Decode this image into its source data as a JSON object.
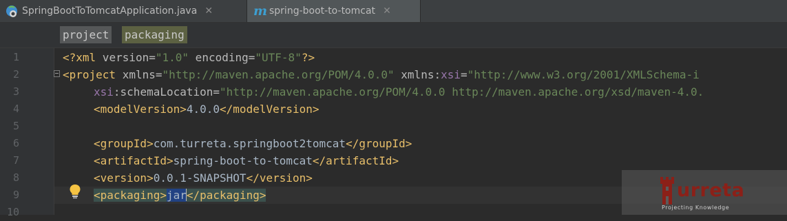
{
  "tabs": [
    {
      "label": "SpringBootToTomcatApplication.java",
      "icon": "spring-java-class-icon",
      "active": false
    },
    {
      "label": "spring-boot-to-tomcat",
      "icon": "maven-m-icon",
      "active": true
    }
  ],
  "breadcrumb": [
    "project",
    "packaging"
  ],
  "line_numbers": [
    "1",
    "2",
    "3",
    "4",
    "5",
    "6",
    "7",
    "8",
    "9",
    "10"
  ],
  "code": {
    "l1": {
      "open": "<?xml",
      "a1": " version",
      "eq1": "=",
      "v1": "\"1.0\"",
      "a2": " encoding",
      "eq2": "=",
      "v2": "\"UTF-8\"",
      "close": "?>"
    },
    "l2": {
      "open": "<project",
      "a1": " xmlns",
      "eq1": "=",
      "v1": "\"http://maven.apache.org/POM/4.0.0\"",
      "a2": " xmlns:",
      "ns": "xsi",
      "eq2": "=",
      "v2": "\"http://www.w3.org/2001/XMLSchema-i"
    },
    "l3": {
      "ns": "xsi",
      "a1": ":schemaLocation",
      "eq1": "=",
      "v1": "\"http://maven.apache.org/POM/4.0.0 http://maven.apache.org/xsd/maven-4.0."
    },
    "l4": {
      "open": "<modelVersion>",
      "text": "4.0.0",
      "close": "</modelVersion>"
    },
    "l6": {
      "open": "<groupId>",
      "text": "com.turreta.springboot2tomcat",
      "close": "</groupId>"
    },
    "l7": {
      "open": "<artifactId>",
      "text": "spring-boot-to-tomcat",
      "close": "</artifactId>"
    },
    "l8": {
      "open": "<version>",
      "text": "0.0.1-SNAPSHOT",
      "close": "</version>"
    },
    "l9": {
      "open": "<packaging>",
      "text_a": "jar",
      "close": "</packaging>"
    }
  },
  "intention_icon": "lightbulb-icon",
  "watermark": {
    "name": "urreta",
    "tagline": "Projecting Knowledge",
    "brand_color": "#8b2018"
  },
  "colors": {
    "background": "#2b2b2b",
    "tag": "#e8bf6a",
    "attribute_value": "#6a8759",
    "namespace": "#9876aa",
    "text": "#a9b7c6",
    "line_number": "#606366"
  }
}
